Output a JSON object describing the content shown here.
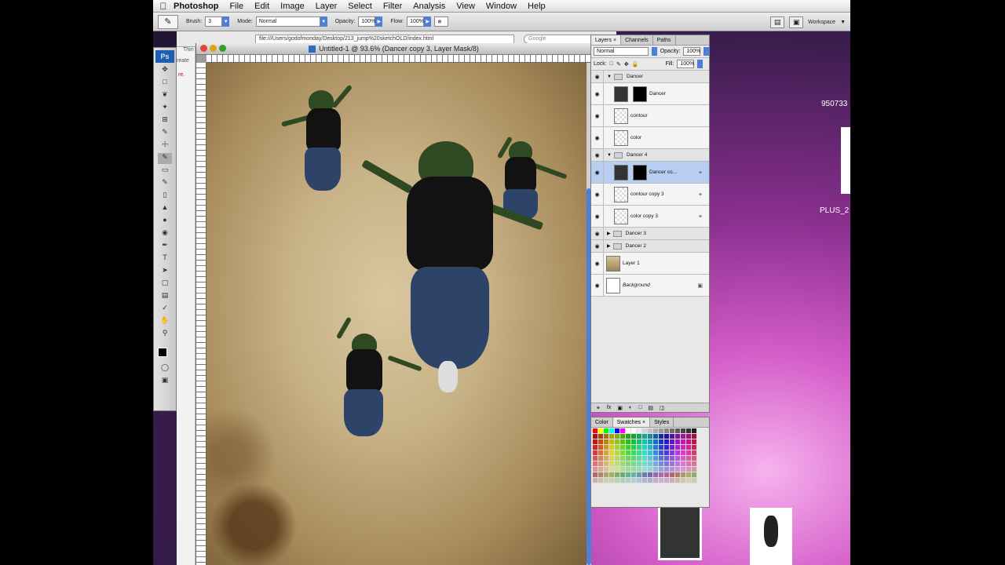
{
  "menubar": {
    "app": "Photoshop",
    "items": [
      "File",
      "Edit",
      "Image",
      "Layer",
      "Select",
      "Filter",
      "Analysis",
      "View",
      "Window",
      "Help"
    ]
  },
  "options": {
    "brush_label": "Brush:",
    "brush_size": "3",
    "mode_label": "Mode:",
    "mode_value": "Normal",
    "opacity_label": "Opacity:",
    "opacity_value": "100%",
    "flow_label": "Flow:",
    "flow_value": "100%",
    "workspace_label": "Workspace"
  },
  "browser": {
    "url": "file:///Users/godofmonday/Desktop/213_jump%20sketchOLD/index.html",
    "search_placeholder": "Google",
    "side_text_1": "Thin",
    "side_text_2": "reate",
    "side_text_3": "re."
  },
  "document": {
    "title": "Untitled-1 @ 93.6% (Dancer copy 3, Layer Mask/8)"
  },
  "toolbox": {
    "logo": "Ps"
  },
  "layers_panel": {
    "tabs": [
      "Layers",
      "Channels",
      "Paths"
    ],
    "blend_mode": "Normal",
    "opacity_label": "Opacity:",
    "opacity_value": "100%",
    "lock_label": "Lock:",
    "fill_label": "Fill:",
    "fill_value": "100%",
    "layers": [
      {
        "name": "Dancer",
        "kind": "group",
        "expanded": true
      },
      {
        "name": "Dancer",
        "kind": "layer-mask",
        "indent": true
      },
      {
        "name": "contour",
        "kind": "layer",
        "indent": true
      },
      {
        "name": "color",
        "kind": "layer",
        "indent": true
      },
      {
        "name": "Dancer 4",
        "kind": "group",
        "expanded": true
      },
      {
        "name": "Dancer co...",
        "kind": "layer-mask",
        "indent": true,
        "selected": true,
        "linked": true
      },
      {
        "name": "contour copy 3",
        "kind": "layer",
        "indent": true,
        "linked": true
      },
      {
        "name": "color copy 3",
        "kind": "layer",
        "indent": true,
        "linked": true
      },
      {
        "name": "Dancer 3",
        "kind": "group",
        "expanded": false
      },
      {
        "name": "Dancer 2",
        "kind": "group",
        "expanded": false
      },
      {
        "name": "Layer 1",
        "kind": "paper"
      },
      {
        "name": "Background",
        "kind": "background",
        "locked": true
      }
    ]
  },
  "swatches_panel": {
    "tabs": [
      "Color",
      "Swatches",
      "Styles"
    ]
  },
  "desktop": {
    "icon_label_1": "950733",
    "icon_label_2": "PLUS_2"
  }
}
